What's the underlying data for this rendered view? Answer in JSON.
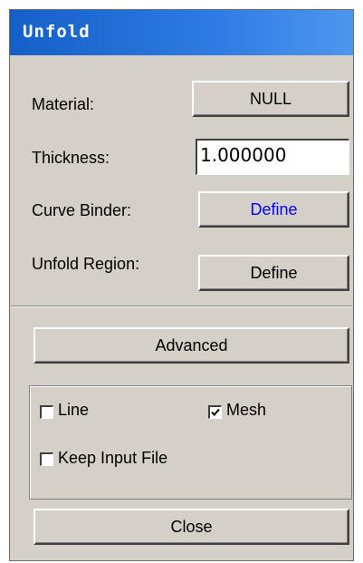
{
  "window": {
    "title": "Unfold"
  },
  "fields": {
    "material_label": "Material:",
    "material_value": "NULL",
    "thickness_label": "Thickness:",
    "thickness_value": "1.000000",
    "curve_binder_label": "Curve Binder:",
    "curve_binder_button": "Define",
    "curve_binder_color": "#0000ff",
    "unfold_region_label": "Unfold Region:",
    "unfold_region_button": "Define"
  },
  "actions": {
    "advanced_label": "Advanced",
    "close_label": "Close"
  },
  "options": {
    "line": {
      "label": "Line",
      "checked": false
    },
    "mesh": {
      "label": "Mesh",
      "checked": true
    },
    "keep_input_file": {
      "label": "Keep Input File",
      "checked": false
    }
  },
  "colors": {
    "title_bar": "#1460c8",
    "dialog_bg": "#d4d0c8"
  }
}
